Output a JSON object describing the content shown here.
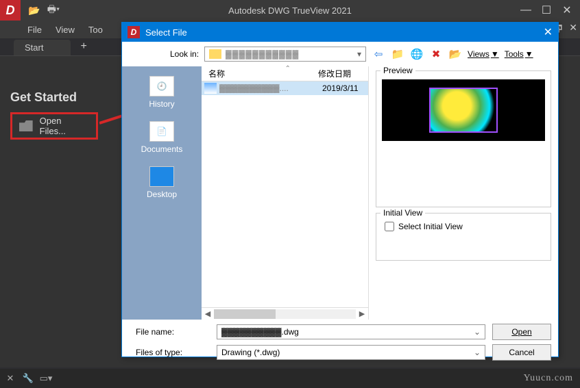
{
  "app": {
    "title": "Autodesk DWG TrueView 2021",
    "icon_letter": "D"
  },
  "menu": {
    "file": "File",
    "view": "View",
    "tools": "Too"
  },
  "tabs": {
    "start": "Start",
    "plus": "+"
  },
  "content": {
    "get_started": "Get Started",
    "open_files": "Open Files..."
  },
  "dialog": {
    "title": "Select File",
    "lookin_label": "Look in:",
    "lookin_value": "▓▓▓▓▓▓▓▓▓▓▓",
    "views_label": "Views",
    "tools_label": "Tools",
    "sidebar": {
      "history": "History",
      "documents": "Documents",
      "desktop": "Desktop"
    },
    "columns": {
      "name": "名称",
      "date": "修改日期"
    },
    "files": [
      {
        "name": "▓▓▓▓▓▓▓▓▓▓....",
        "date": "2019/3/11"
      }
    ],
    "preview_label": "Preview",
    "initial_view_label": "Initial View",
    "select_initial_view": "Select Initial View",
    "file_name_label": "File name:",
    "file_name_value": "▓▓▓▓▓▓▓▓▓▓.dwg",
    "file_type_label": "Files of type:",
    "file_type_value": "Drawing (*.dwg)",
    "open_btn": "Open",
    "cancel_btn": "Cancel"
  },
  "watermark": "Yuucn.com",
  "colors": {
    "accent": "#0078d7",
    "highlight": "#d62828"
  }
}
